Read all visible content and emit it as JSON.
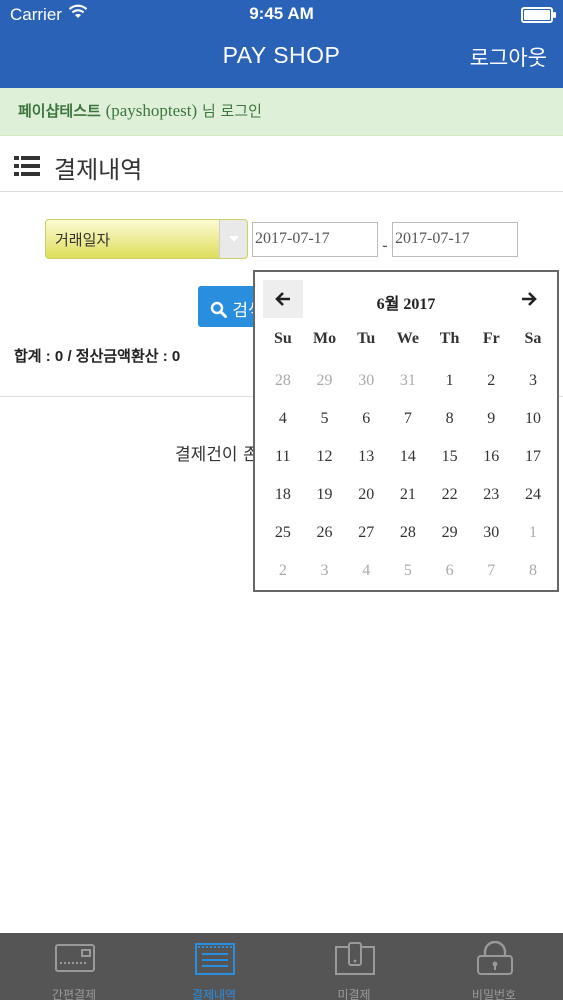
{
  "status_bar": {
    "carrier": "Carrier",
    "time": "9:45 AM"
  },
  "header": {
    "title": "PAY SHOP",
    "logout_label": "로그아웃"
  },
  "login_bar": {
    "name": "페이샵테스트",
    "user_id": "(payshoptest)",
    "suffix": " 님 로그인"
  },
  "section": {
    "title": "결제내역"
  },
  "filter": {
    "select_value": "거래일자",
    "date_from": "2017-07-17",
    "date_separator": "-",
    "date_to": "2017-07-17",
    "search_label": "검색"
  },
  "summary": {
    "total_text": "합계 : 0 / 정산금액환산 : 0"
  },
  "empty_message": "결제건이 존재하지 않습니다.",
  "datepicker": {
    "title": "6월 2017",
    "weekdays": [
      "Su",
      "Mo",
      "Tu",
      "We",
      "Th",
      "Fr",
      "Sa"
    ],
    "weeks": [
      [
        "28",
        "29",
        "30",
        "31",
        "1",
        "2",
        "3"
      ],
      [
        "4",
        "5",
        "6",
        "7",
        "8",
        "9",
        "10"
      ],
      [
        "11",
        "12",
        "13",
        "14",
        "15",
        "16",
        "17"
      ],
      [
        "18",
        "19",
        "20",
        "21",
        "22",
        "23",
        "24"
      ],
      [
        "25",
        "26",
        "27",
        "28",
        "29",
        "30",
        "1"
      ],
      [
        "2",
        "3",
        "4",
        "5",
        "6",
        "7",
        "8"
      ]
    ],
    "other_month_cells": [
      [
        0,
        0
      ],
      [
        0,
        1
      ],
      [
        0,
        2
      ],
      [
        0,
        3
      ],
      [
        4,
        6
      ],
      [
        5,
        0
      ],
      [
        5,
        1
      ],
      [
        5,
        2
      ],
      [
        5,
        3
      ],
      [
        5,
        4
      ],
      [
        5,
        5
      ],
      [
        5,
        6
      ]
    ]
  },
  "tabs": [
    {
      "label": "간편결제",
      "icon": "card-terminal-icon"
    },
    {
      "label": "결제내역",
      "icon": "receipt-list-icon",
      "active": true
    },
    {
      "label": "미결제",
      "icon": "mobile-device-icon"
    },
    {
      "label": "비밀번호",
      "icon": "lock-icon"
    }
  ],
  "colors": {
    "header": "#2a62b8",
    "accent": "#2a8ede",
    "login_bar": "#dff0d8",
    "tabbar": "#555555"
  }
}
